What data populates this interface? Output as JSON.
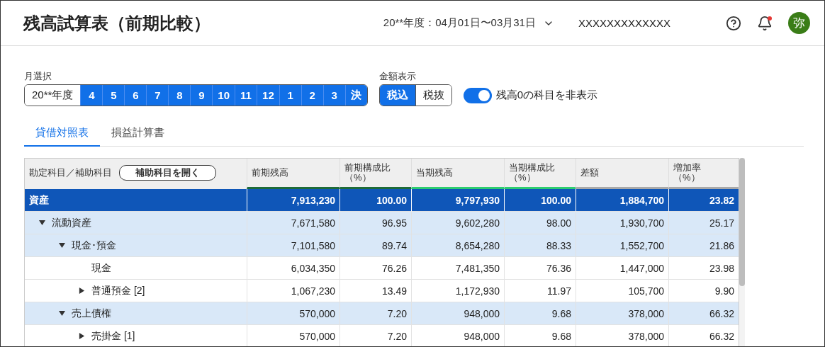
{
  "header": {
    "title": "残高試算表（前期比較）",
    "period": "20**年度：04月01日〜03月31日",
    "company": "XXXXXXXXXXXXX",
    "avatar": "弥",
    "notification": true
  },
  "month_select": {
    "label": "月選択",
    "items": [
      {
        "label": "20**年度",
        "selected": false
      },
      {
        "label": "4",
        "selected": true
      },
      {
        "label": "5",
        "selected": true
      },
      {
        "label": "6",
        "selected": true
      },
      {
        "label": "7",
        "selected": true
      },
      {
        "label": "8",
        "selected": true
      },
      {
        "label": "9",
        "selected": true
      },
      {
        "label": "10",
        "selected": true
      },
      {
        "label": "11",
        "selected": true
      },
      {
        "label": "12",
        "selected": true
      },
      {
        "label": "1",
        "selected": true
      },
      {
        "label": "2",
        "selected": true
      },
      {
        "label": "3",
        "selected": true
      },
      {
        "label": "決",
        "selected": true
      }
    ]
  },
  "amount_display": {
    "label": "金額表示",
    "items": [
      {
        "label": "税込",
        "selected": true
      },
      {
        "label": "税抜",
        "selected": false
      }
    ]
  },
  "hide_zero": {
    "label": "残高0の科目を非表示",
    "on": true
  },
  "tabs": [
    {
      "label": "貸借対照表",
      "selected": true
    },
    {
      "label": "損益計算書",
      "selected": false
    }
  ],
  "table": {
    "first_column": "勘定科目／補助科目",
    "open_button": "補助科目を開く",
    "columns": [
      {
        "label": "前期残高",
        "color": "#1e6b3a"
      },
      {
        "label": "前期構成比（%）",
        "color": "#1e6b3a"
      },
      {
        "label": "当期残高",
        "color": "#2ecc71"
      },
      {
        "label": "当期構成比（%）",
        "color": "#2ecc71"
      },
      {
        "label": "差額",
        "color": "#a9a9a9"
      },
      {
        "label": "増加率（%）",
        "color": "#a9a9a9"
      }
    ],
    "rows": [
      {
        "kind": "total",
        "name": "資産",
        "values": [
          "7,913,230",
          "100.00",
          "9,797,930",
          "100.00",
          "1,884,700",
          "23.82"
        ],
        "children": [
          {
            "kind": "group",
            "name": "流動資産",
            "expanded": true,
            "values": [
              "7,671,580",
              "96.95",
              "9,602,280",
              "98.00",
              "1,930,700",
              "25.17"
            ],
            "children": [
              {
                "kind": "group",
                "name": "現金･預金",
                "expanded": true,
                "values": [
                  "7,101,580",
                  "89.74",
                  "8,654,280",
                  "88.33",
                  "1,552,700",
                  "21.86"
                ],
                "children": [
                  {
                    "kind": "item",
                    "name": "現金",
                    "values": [
                      "6,034,350",
                      "76.26",
                      "7,481,350",
                      "76.36",
                      "1,447,000",
                      "23.98"
                    ]
                  },
                  {
                    "kind": "item",
                    "name": "普通預金 [2]",
                    "expanded": false,
                    "values": [
                      "1,067,230",
                      "13.49",
                      "1,172,930",
                      "11.97",
                      "105,700",
                      "9.90"
                    ]
                  }
                ]
              },
              {
                "kind": "group",
                "name": "売上債権",
                "expanded": true,
                "values": [
                  "570,000",
                  "7.20",
                  "948,000",
                  "9.68",
                  "378,000",
                  "66.32"
                ],
                "children": [
                  {
                    "kind": "item",
                    "name": "売掛金 [1]",
                    "expanded": false,
                    "values": [
                      "570,000",
                      "7.20",
                      "948,000",
                      "9.68",
                      "378,000",
                      "66.32"
                    ]
                  }
                ]
              }
            ]
          }
        ]
      }
    ]
  }
}
